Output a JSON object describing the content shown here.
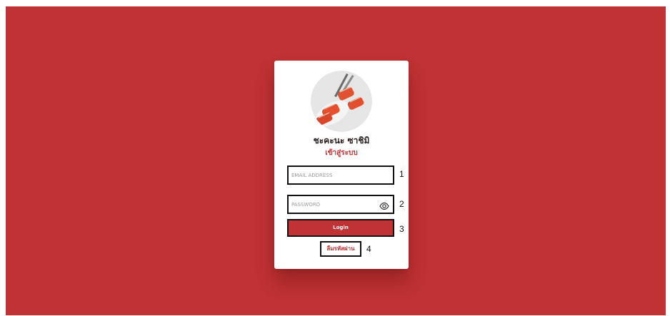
{
  "login_card": {
    "brand_name": "ชะคะนะ ซาชิมิ",
    "subtitle": "เข้าสู่ระบบ",
    "email": {
      "placeholder": "EMAIL ADDRESS",
      "value": ""
    },
    "password": {
      "placeholder": "PASSWORD",
      "value": ""
    },
    "login_label": "Login",
    "forgot_label": "ลืมรหัสผ่าน"
  },
  "markers": [
    "1",
    "2",
    "3",
    "4"
  ],
  "icons": {
    "logo": "sushi-logo-icon",
    "show_password": "eye-icon"
  },
  "colors": {
    "background": "#c03233",
    "card": "#ffffff",
    "accent": "#c03233",
    "annotation_border": "#111111"
  }
}
